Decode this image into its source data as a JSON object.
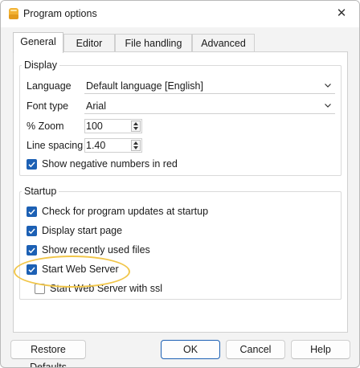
{
  "window": {
    "title": "Program options",
    "close_glyph": "✕"
  },
  "tabs": [
    {
      "label": "General",
      "active": true
    },
    {
      "label": "Editor",
      "active": false
    },
    {
      "label": "File handling",
      "active": false
    },
    {
      "label": "Advanced",
      "active": false
    }
  ],
  "display": {
    "title": "Display",
    "language": {
      "label": "Language",
      "value": "Default language [English]"
    },
    "font_type": {
      "label": "Font type",
      "value": "Arial"
    },
    "zoom": {
      "label": "% Zoom",
      "value": "100"
    },
    "line_spacing": {
      "label": "Line spacing",
      "value": "1.40"
    },
    "negative_red": {
      "label": "Show negative numbers in red",
      "checked": true
    }
  },
  "startup": {
    "title": "Startup",
    "check_updates": {
      "label": "Check for program updates at startup",
      "checked": true
    },
    "start_page": {
      "label": "Display start page",
      "checked": true
    },
    "recent_files": {
      "label": "Show recently used files",
      "checked": true
    },
    "web_server": {
      "label": "Start Web Server",
      "checked": true
    },
    "web_server_ssl": {
      "label": "Start Web Server with ssl",
      "checked": false
    }
  },
  "buttons": {
    "restore": "Restore Defaults",
    "ok": "OK",
    "cancel": "Cancel",
    "help": "Help"
  },
  "colors": {
    "accent": "#1c60b4",
    "highlight": "#f1c64a",
    "app_icon": "#f2b233"
  },
  "icons": [
    "app-icon",
    "close-icon",
    "chevron-down-icon",
    "spin-up-icon",
    "spin-down-icon",
    "check-icon"
  ]
}
